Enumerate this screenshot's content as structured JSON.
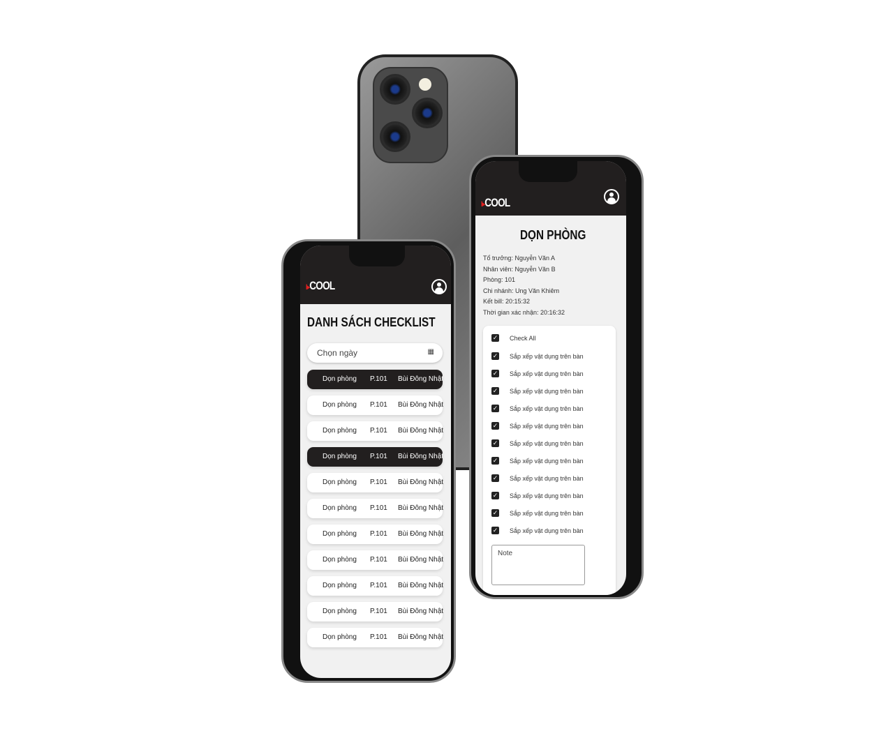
{
  "brand": {
    "logo": "I-COOL",
    "accent": "#e02020",
    "dark": "#221f1f"
  },
  "list_screen": {
    "title": "DANH SÁCH CHECKLIST",
    "date_placeholder": "Chọn ngày",
    "rows": [
      {
        "task": "Dọn phòng",
        "room": "P.101",
        "staff": "Bùi Đông Nhật",
        "selected": true
      },
      {
        "task": "Dọn phòng",
        "room": "P.101",
        "staff": "Bùi Đông Nhật",
        "selected": false
      },
      {
        "task": "Dọn phòng",
        "room": "P.101",
        "staff": "Bùi Đông Nhật",
        "selected": false
      },
      {
        "task": "Dọn phòng",
        "room": "P.101",
        "staff": "Bùi Đông Nhật",
        "selected": true
      },
      {
        "task": "Dọn phòng",
        "room": "P.101",
        "staff": "Bùi Đông Nhật",
        "selected": false
      },
      {
        "task": "Dọn phòng",
        "room": "P.101",
        "staff": "Bùi Đông Nhật",
        "selected": false
      },
      {
        "task": "Dọn phòng",
        "room": "P.101",
        "staff": "Bùi Đông Nhật",
        "selected": false
      },
      {
        "task": "Dọn phòng",
        "room": "P.101",
        "staff": "Bùi Đông Nhật",
        "selected": false
      },
      {
        "task": "Dọn phòng",
        "room": "P.101",
        "staff": "Bùi Đông Nhật",
        "selected": false
      },
      {
        "task": "Dọn phòng",
        "room": "P.101",
        "staff": "Bùi Đông Nhật",
        "selected": false
      },
      {
        "task": "Dọn phòng",
        "room": "P.101",
        "staff": "Bùi Đông Nhật",
        "selected": false
      }
    ]
  },
  "detail_screen": {
    "title": "DỌN PHÒNG",
    "info": [
      "Tổ trưởng: Nguyễn Văn A",
      "Nhân viên: Nguyễn Văn B",
      "Phòng: 101",
      "Chi nhánh: Ung Văn Khiêm",
      "Kết bill: 20:15:32",
      "Thời gian xác nhận: 20:16:32"
    ],
    "check_all": "Check All",
    "items": [
      "Sắp xếp vật dụng trên bàn",
      "Sắp xếp vật dụng trên bàn",
      "Sắp xếp vật dụng trên bàn",
      "Sắp xếp vật dụng trên bàn",
      "Sắp xếp vật dụng trên bàn",
      "Sắp xếp vật dụng trên bàn",
      "Sắp xếp vật dụng trên bàn",
      "Sắp xếp vật dụng trên bàn",
      "Sắp xếp vật dụng trên bàn",
      "Sắp xếp vật dụng trên bàn",
      "Sắp xếp vật dụng trên bàn"
    ],
    "note_placeholder": "Note"
  }
}
